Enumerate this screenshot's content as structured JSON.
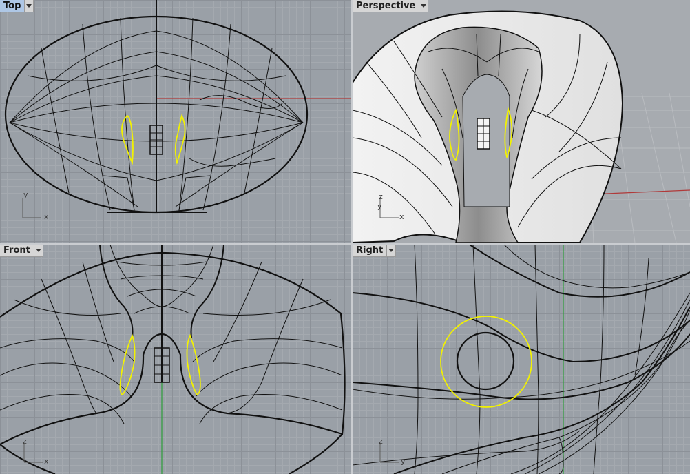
{
  "viewports": {
    "top": {
      "label": "Top",
      "axis1": "y",
      "axis2": "x"
    },
    "perspective": {
      "label": "Perspective",
      "axis1": "z",
      "axis2": "y",
      "axis3": "x"
    },
    "front": {
      "label": "Front",
      "axis1": "z",
      "axis2": "x"
    },
    "right": {
      "label": "Right",
      "axis1": "z",
      "axis2": "y"
    }
  },
  "colors": {
    "grid_bg": "#9aa0a7",
    "x_axis": "#b03a3a",
    "y_axis": "#2e9e3a",
    "curve": "#111111",
    "selected_curve": "#f2f200",
    "active_tab": "#aec7e6"
  }
}
